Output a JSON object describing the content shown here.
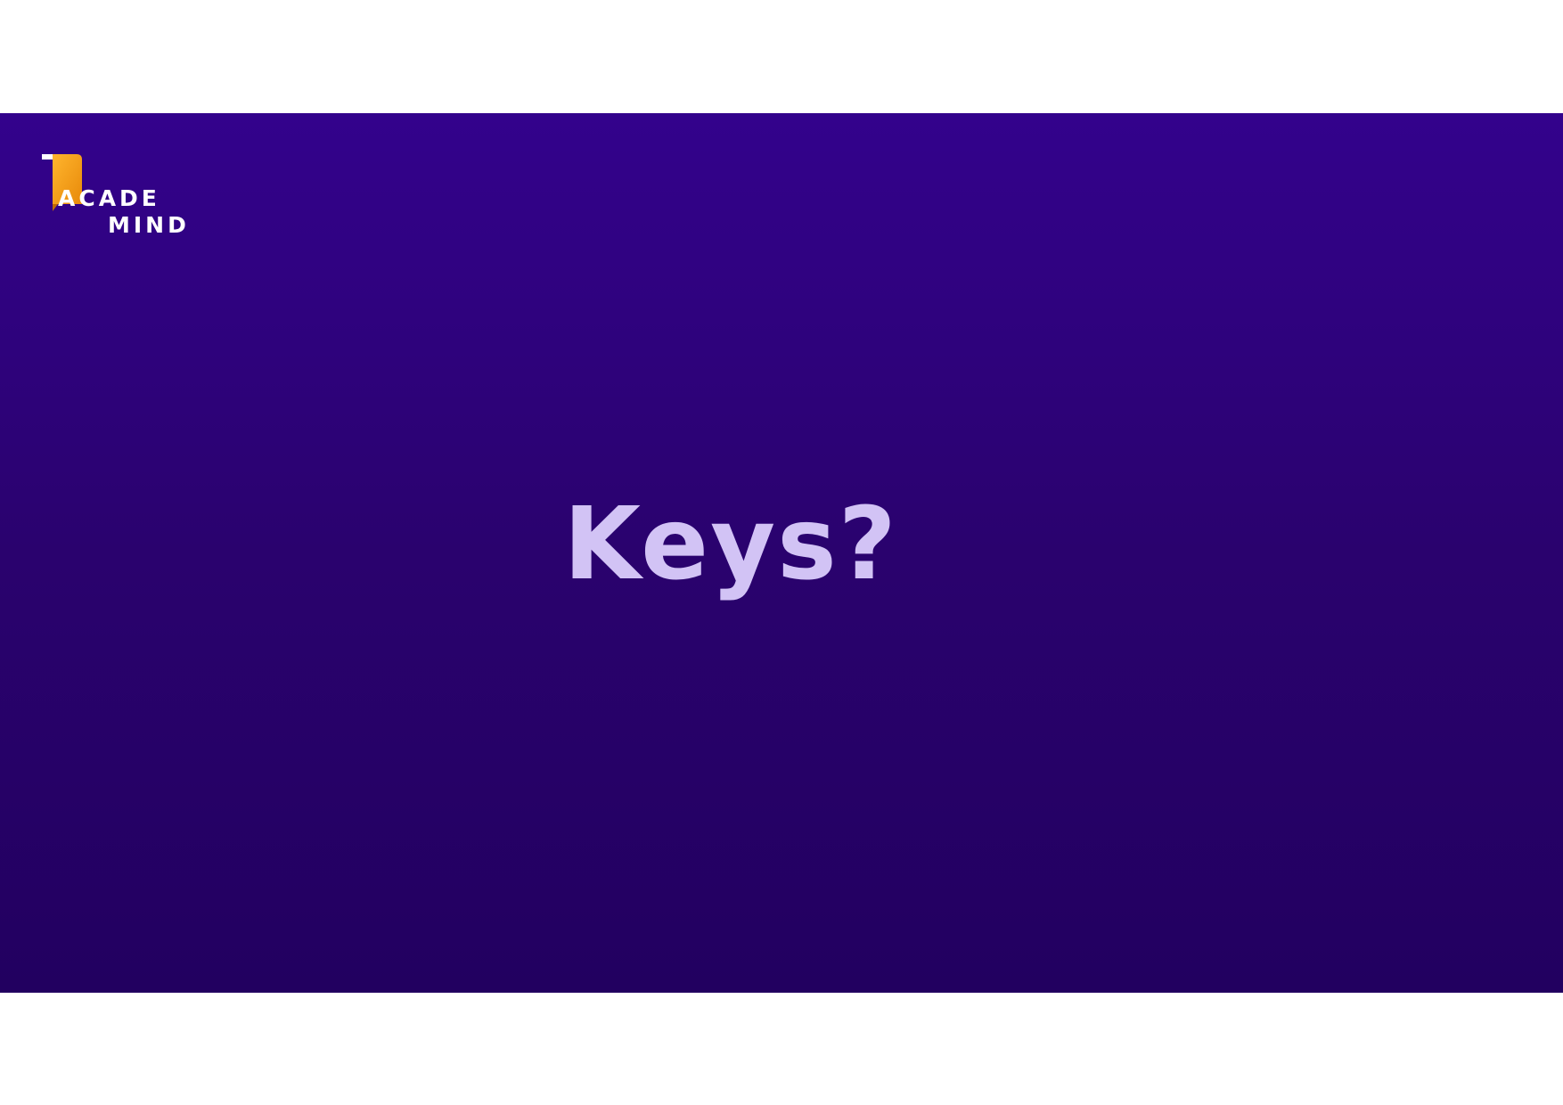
{
  "slide": {
    "title": "Keys?",
    "background_top": "#33028c",
    "background_bottom": "#220060",
    "title_color": "#d2c3f5"
  },
  "logo": {
    "line1": "ACADE",
    "line2": "MIND",
    "accent_color": "#f5a21a",
    "icon": "bookmark-icon"
  }
}
